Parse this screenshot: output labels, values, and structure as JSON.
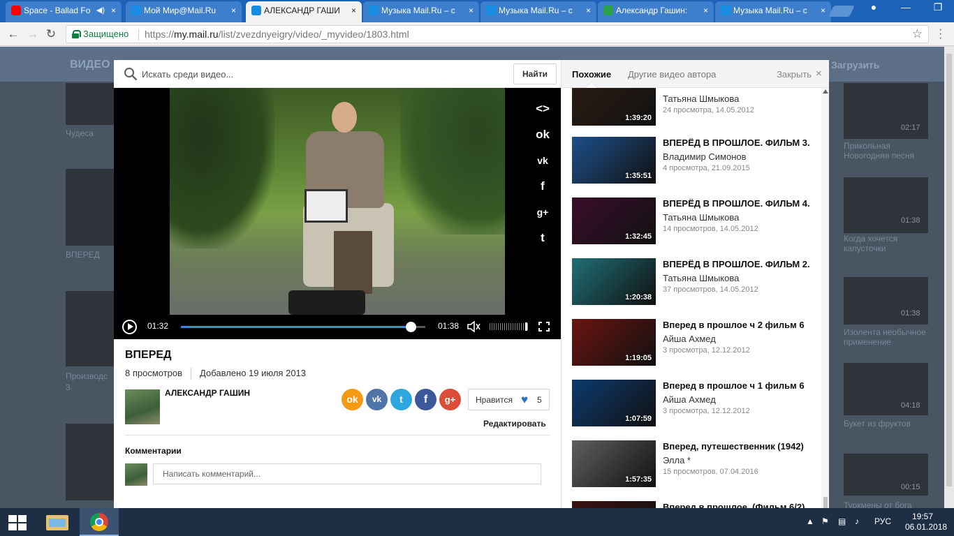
{
  "browser": {
    "tabs": [
      {
        "title": "Space - Ballad Fo",
        "color": "#ff0000",
        "active": false
      },
      {
        "title": "Мой Мир@Mail.Ru",
        "color": "#168de2",
        "active": false
      },
      {
        "title": "АЛЕКСАНДР ГАШИ",
        "color": "#168de2",
        "active": true
      },
      {
        "title": "Музыка Mail.Ru – с",
        "color": "#168de2",
        "active": false
      },
      {
        "title": "Музыка Mail.Ru – с",
        "color": "#168de2",
        "active": false
      },
      {
        "title": "Александр Гашин:",
        "color": "#2aa24b",
        "active": false
      },
      {
        "title": "Музыка Mail.Ru – с",
        "color": "#168de2",
        "active": false
      }
    ],
    "secure_label": "Защищено",
    "url_scheme": "https://",
    "url_host": "my.mail.ru",
    "url_path": "/list/zvezdnyeigry/video/_myvideo/1803.html"
  },
  "background_page": {
    "header_title": "ВИДЕО",
    "upload_label": "Загрузить",
    "left_captions": [
      "Чудеса",
      "ВПЕРЕД",
      "Производс",
      "3"
    ],
    "right_captions": [
      {
        "title": "Прикольная Новогодняя песня",
        "dur": "02:17"
      },
      {
        "title": "Когда хочется капусточки",
        "dur": "01:38"
      },
      {
        "title": "Изолента необычное применение",
        "dur": "01:38"
      },
      {
        "title": "Букет из фруктов",
        "dur": "04:18"
      },
      {
        "title": "Туркмены от бога",
        "dur": "00:15"
      }
    ]
  },
  "search": {
    "placeholder": "Искать среди видео...",
    "button": "Найти"
  },
  "player": {
    "current_time": "01:32",
    "duration": "01:38",
    "progress": 0.939,
    "volume": 0.95,
    "share_icons": [
      "embed-icon",
      "odnoklassniki-icon",
      "vk-icon",
      "facebook-icon",
      "google-plus-icon",
      "twitter-icon"
    ]
  },
  "video": {
    "title": "ВПЕРЕД",
    "views": "8 просмотров",
    "added": "Добавлено 19 июля 2013",
    "author": "АЛЕКСАНДР ГАШИН",
    "like_label": "Нравится",
    "like_count": "5",
    "edit_label": "Редактировать",
    "social_colors": {
      "ok": "#f59a12",
      "vk": "#4f75a6",
      "twitter": "#2ea7e0",
      "facebook": "#3b5998",
      "gplus": "#dd4b39"
    }
  },
  "comments": {
    "title": "Комментарии",
    "placeholder": "Написать комментарий..."
  },
  "related": {
    "tab_similar": "Похожие",
    "tab_author": "Другие видео автора",
    "close_label": "Закрыть",
    "items": [
      {
        "title": "",
        "author": "Татьяна Шмыкова",
        "stats": "24 просмотра, 14.05.2012",
        "duration": "1:39:20",
        "thumb": "#2a1d14"
      },
      {
        "title": "ВПЕРЁД В ПРОШЛОЕ. ФИЛЬМ 3.",
        "author": "Владимир Симонов",
        "stats": "4 просмотра, 21.09.2015",
        "duration": "1:35:51",
        "thumb": "#1d4f8a"
      },
      {
        "title": "ВПЕРЁД В ПРОШЛОЕ. ФИЛЬМ 4.",
        "author": "Татьяна Шмыкова",
        "stats": "14 просмотров, 14.05.2012",
        "duration": "1:32:45",
        "thumb": "#3a0d2a"
      },
      {
        "title": "ВПЕРЁД В ПРОШЛОЕ. ФИЛЬМ 2.",
        "author": "Татьяна Шмыкова",
        "stats": "37 просмотров, 14.05.2012",
        "duration": "1:20:38",
        "thumb": "#1f6f76"
      },
      {
        "title": "Вперед в прошлое ч 2 фильм 6",
        "author": "Айша Ахмед",
        "stats": "3 просмотра, 12.12.2012",
        "duration": "1:19:05",
        "thumb": "#6b1410"
      },
      {
        "title": "Вперед в прошлое ч 1 фильм 6",
        "author": "Айша Ахмед",
        "stats": "3 просмотра, 12.12.2012",
        "duration": "1:07:59",
        "thumb": "#0c3a6e"
      },
      {
        "title": "Вперед, путешественник (1942)",
        "author": "Элла *",
        "stats": "15 просмотров, 07.04.2016",
        "duration": "1:57:35",
        "thumb": "#5f5f5f"
      },
      {
        "title": "Вперед в прошлое. (Фильм 6/2)",
        "author": "",
        "stats": "",
        "duration": "",
        "thumb": "#3b1010"
      }
    ]
  },
  "taskbar": {
    "language": "РУС",
    "time": "19:57",
    "date": "06.01.2018"
  }
}
